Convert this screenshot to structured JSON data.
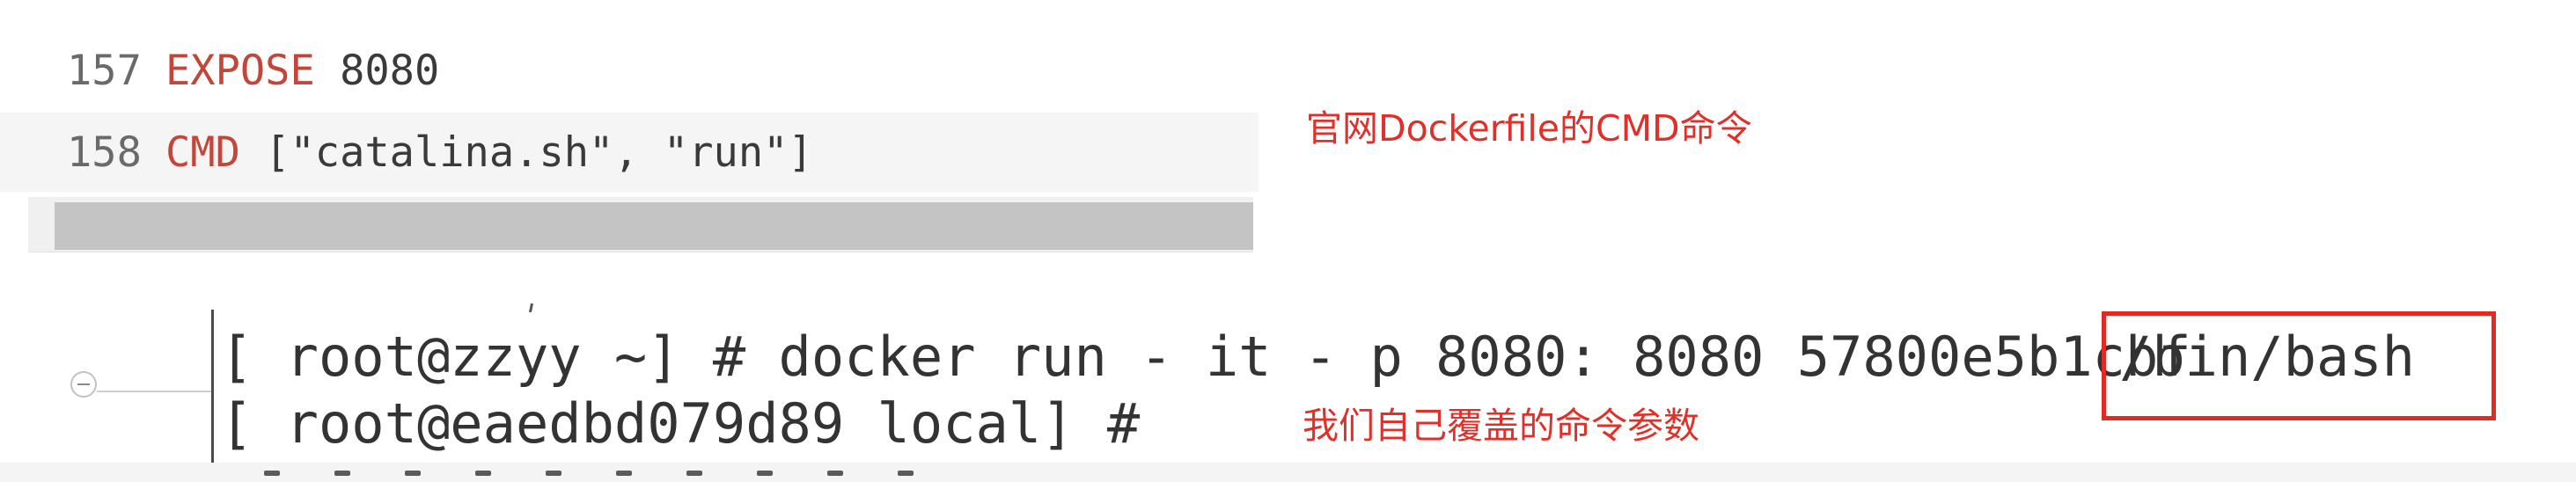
{
  "code": {
    "lines": [
      {
        "number": "157",
        "keyword": "EXPOSE",
        "rest": " 8080"
      },
      {
        "number": "158",
        "keyword": "CMD",
        "rest": " [\"catalina.sh\", \"run\"]"
      }
    ]
  },
  "annotations": {
    "official_cmd": "官网Dockerfile的CMD命令",
    "override_params": "我们自己覆盖的命令参数"
  },
  "terminal": {
    "line1_prefix": "[ root@zzyy ~] # docker run - it - p 8080: 8080 57800e5b1cbf ",
    "line1_highlight": "/bin/bash",
    "line2": "[ root@eaedbd079d89 local] #"
  },
  "colors": {
    "annotation": "#e0302a",
    "keyword": "#c2473a",
    "highlight_border": "#e12b22"
  }
}
